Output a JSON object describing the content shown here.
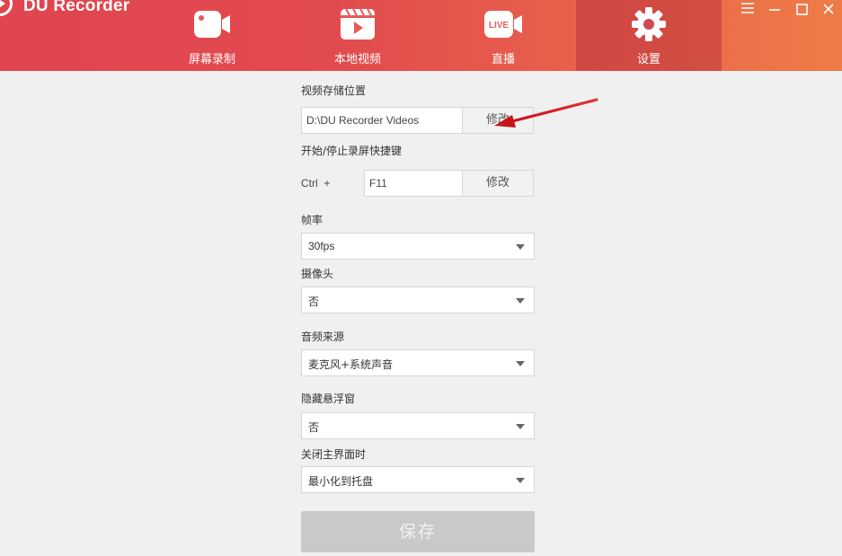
{
  "app": {
    "title": "DU Recorder"
  },
  "nav": {
    "tabs": [
      {
        "label": "屏幕录制",
        "icon": "video-camera-icon"
      },
      {
        "label": "本地视频",
        "icon": "video-file-icon"
      },
      {
        "label": "直播",
        "icon": "live-camera-icon",
        "badge": "LIVE"
      },
      {
        "label": "设置",
        "icon": "gear-icon",
        "active": true
      }
    ]
  },
  "settings": {
    "storage": {
      "label": "视频存储位置",
      "value": "D:\\DU Recorder Videos",
      "button": "修改"
    },
    "hotkey": {
      "label": "开始/停止录屏快捷键",
      "prefix": "Ctrl  +",
      "value": "F11",
      "button": "修改"
    },
    "fps": {
      "label": "帧率",
      "value": "30fps"
    },
    "camera": {
      "label": "摄像头",
      "value": "否"
    },
    "audio": {
      "label": "音频来源",
      "value": "麦克风+系统声音"
    },
    "floating": {
      "label": "隐藏悬浮窗",
      "value": "否"
    },
    "close": {
      "label": "关闭主界面时",
      "value": "最小化到托盘"
    },
    "save": "保存"
  },
  "colors": {
    "header_start": "#e04550",
    "header_end": "#ee7c48",
    "annotation": "#d4161c"
  }
}
